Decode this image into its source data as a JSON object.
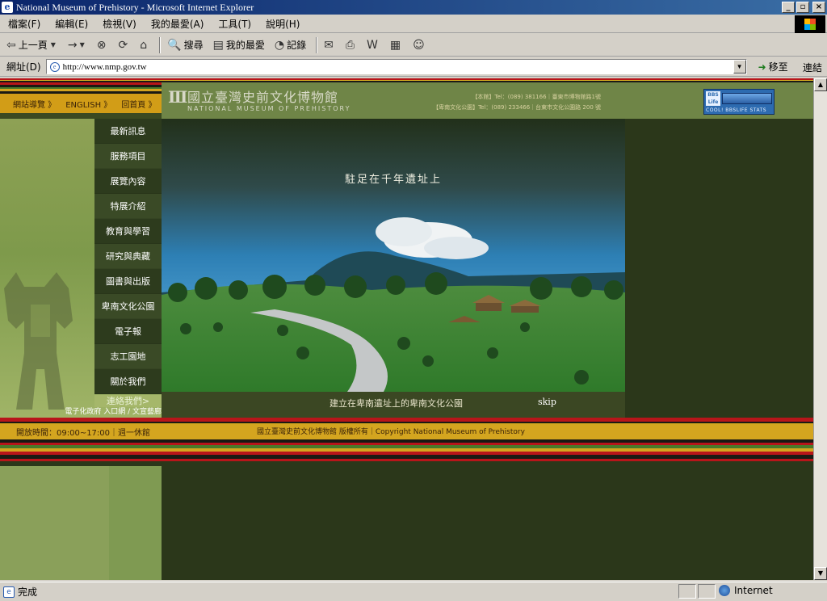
{
  "window": {
    "title": "National Museum of Prehistory - Microsoft Internet Explorer",
    "icon": "ie-icon",
    "buttons": [
      "_",
      "▫",
      "×"
    ]
  },
  "menubar": [
    "檔案(F)",
    "編輯(E)",
    "檢視(V)",
    "我的最愛(A)",
    "工具(T)",
    "說明(H)"
  ],
  "toolbar": {
    "back": "上一頁",
    "forward": "→",
    "search": "搜尋",
    "favorites": "我的最愛",
    "history": "記錄"
  },
  "address": {
    "label": "網址(D)",
    "url": "http://www.nmp.gov.tw",
    "go": "移至",
    "links": "連結"
  },
  "page": {
    "header": {
      "nav": [
        "網站導覽 》",
        "ENGLISH 》",
        "回首頁 》"
      ],
      "logo_zh": "國立臺灣史前文化博物館",
      "logo_en": "NATIONAL MUSEUM OF PREHISTORY",
      "contact_1": "【本館】Tel：(089) 381166｜臺東市博物館路1號",
      "contact_2": "【卑南文化公園】Tel：(089) 233466｜台東市文化公園路 200 號",
      "bbs_text": "COOL! BBSLIFE STATS"
    },
    "menu": [
      "最新訊息",
      "服務項目",
      "展覽內容",
      "特展介紹",
      "教育與學習",
      "研究與典藏",
      "圖書與出版",
      "卑南文化公園",
      "電子報",
      "志工園地",
      "關於我們"
    ],
    "contact_link": "連絡我們>",
    "egov": "電子化政府 入口網 / 文宣藝廊",
    "hero_title": "駐足在千年遺址上",
    "hero_caption": "建立在卑南遺址上的卑南文化公園",
    "skip": "skip",
    "hours": "開放時間：09:00~17:00｜週一休館",
    "copyright": "國立臺灣史前文化博物館 版權所有｜Copyright National Museum of Prehistory"
  },
  "status": {
    "text": "完成",
    "zone": "Internet"
  },
  "colors": {
    "olive_dark": "#2b371a",
    "olive_header": "#6f8547",
    "gold": "#d4a51f",
    "red_stripe": "#b8151a",
    "menu_dark": "#2d3b1d"
  }
}
